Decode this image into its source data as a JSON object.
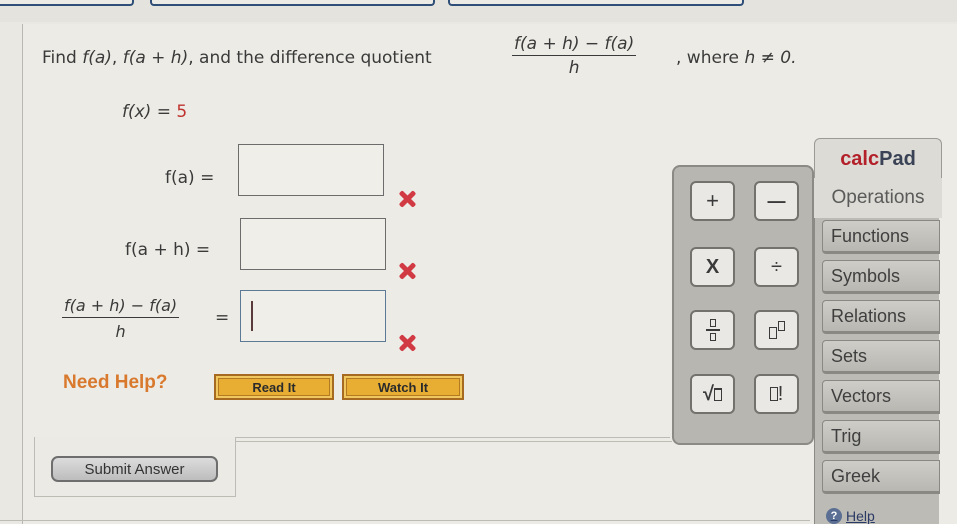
{
  "question": {
    "prompt_prefix": "Find ",
    "prompt_fa": "f(a)",
    "prompt_sep1": ", ",
    "prompt_fah": "f(a + h)",
    "prompt_mid": ", and the difference quotient",
    "dq_numerator": "f(a + h) − f(a)",
    "dq_denominator": "h",
    "prompt_suffix": ", where ",
    "prompt_condition": "h ≠ 0.",
    "function_lhs": "f(x) = ",
    "function_value": "5"
  },
  "answers": [
    {
      "label": "f(a)  =",
      "value": "",
      "status": "incorrect"
    },
    {
      "label": "f(a + h)  =",
      "value": "",
      "status": "incorrect"
    },
    {
      "label_numerator": "f(a + h) − f(a)",
      "label_denominator": "h",
      "equals": "=",
      "value": "",
      "status": "incorrect",
      "focused": true
    }
  ],
  "help": {
    "heading": "Need Help?",
    "read_it": "Read It",
    "watch_it": "Watch It"
  },
  "submit_label": "Submit Answer",
  "calcpad": {
    "title_part1": "calc",
    "title_part2": "Pad",
    "active_tab": "Operations",
    "keys": [
      {
        "name": "plus-key",
        "glyph": "+"
      },
      {
        "name": "minus-key",
        "glyph": "—"
      },
      {
        "name": "multiply-key",
        "glyph": "X"
      },
      {
        "name": "divide-key",
        "glyph": "÷"
      },
      {
        "name": "fraction-key",
        "glyph": "fraction"
      },
      {
        "name": "exponent-key",
        "glyph": "exponent"
      },
      {
        "name": "sqrt-key",
        "glyph": "√"
      },
      {
        "name": "factorial-key",
        "glyph": "!"
      }
    ],
    "tabs": [
      "Functions",
      "Symbols",
      "Relations",
      "Sets",
      "Vectors",
      "Trig",
      "Greek"
    ],
    "help_label": "Help",
    "help_icon": "?"
  },
  "colors": {
    "incorrect_mark": "#d23a43",
    "need_help": "#d9792d",
    "help_button": "#e7ae33",
    "calc_red": "#b3202a",
    "calc_navy": "#3a4256",
    "function_value": "#c0322e"
  }
}
